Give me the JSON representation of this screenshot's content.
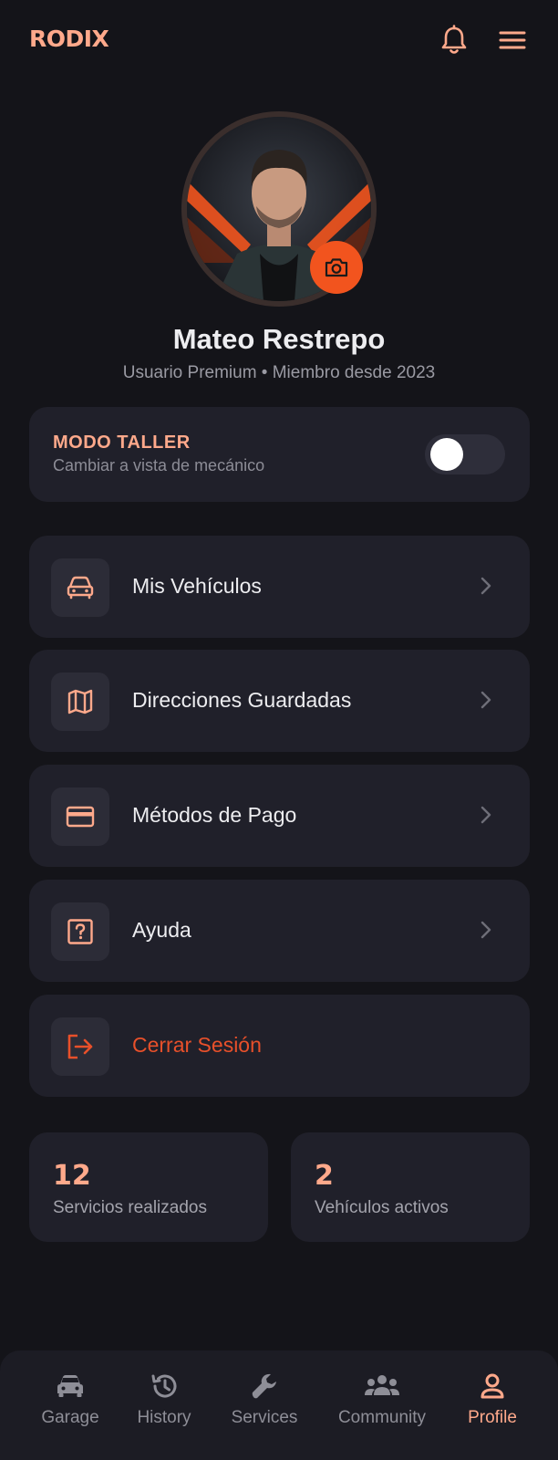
{
  "app": {
    "logo": "RODIX"
  },
  "colors": {
    "accent": "#FFA98B",
    "brand_orange": "#F2541E",
    "danger": "#E8502A",
    "background": "#141419",
    "card": "#20202A"
  },
  "header": {
    "notifications_icon": "bell-icon",
    "menu_icon": "hamburger-icon"
  },
  "profile": {
    "name": "Mateo Restrepo",
    "subtitle": "Usuario Premium • Miembro desde 2023",
    "camera_icon": "camera-icon"
  },
  "workshop_mode": {
    "title": "MODO TALLER",
    "subtitle": "Cambiar a vista de mecánico",
    "enabled": false
  },
  "menu": [
    {
      "label": "Mis Vehículos",
      "icon": "car-icon"
    },
    {
      "label": "Direcciones Guardadas",
      "icon": "map-icon"
    },
    {
      "label": "Métodos de Pago",
      "icon": "credit-card-icon"
    },
    {
      "label": "Ayuda",
      "icon": "help-icon"
    },
    {
      "label": "Cerrar Sesión",
      "icon": "logout-icon"
    }
  ],
  "stats": [
    {
      "value": "12",
      "label": "Servicios realizados"
    },
    {
      "value": "2",
      "label": "Vehículos activos"
    }
  ],
  "bottom_nav": [
    {
      "label": "Garage",
      "icon": "car-icon",
      "active": false
    },
    {
      "label": "History",
      "icon": "history-icon",
      "active": false
    },
    {
      "label": "Services",
      "icon": "wrench-icon",
      "active": false
    },
    {
      "label": "Community",
      "icon": "group-icon",
      "active": false
    },
    {
      "label": "Profile",
      "icon": "person-icon",
      "active": true
    }
  ]
}
